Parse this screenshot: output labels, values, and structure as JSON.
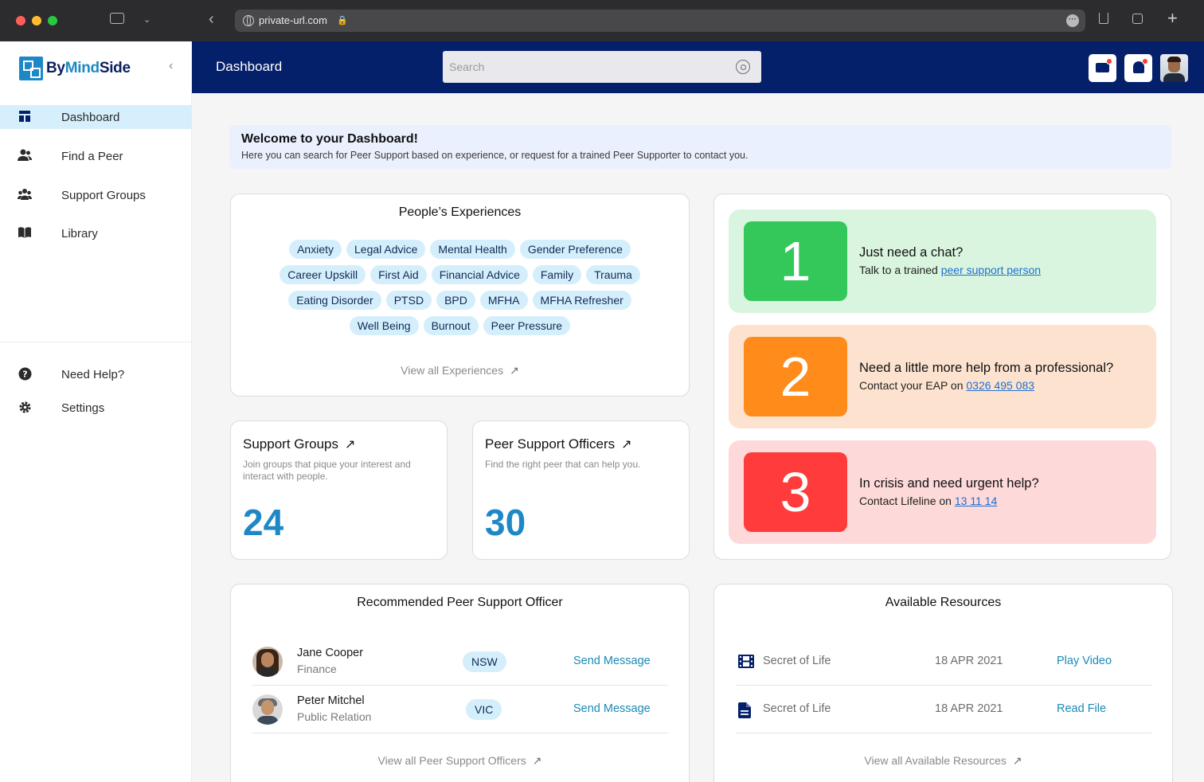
{
  "browser": {
    "url": "private-url.com"
  },
  "sidebar": {
    "brand_prefix": "By",
    "brand_mind": "Mind",
    "brand_suffix": "Side",
    "nav": [
      {
        "label": "Dashboard",
        "icon": "dashboard-icon",
        "active": true
      },
      {
        "label": "Find a Peer",
        "icon": "people-icon",
        "active": false
      },
      {
        "label": "Support Groups",
        "icon": "group-icon",
        "active": false
      },
      {
        "label": "Library",
        "icon": "book-icon",
        "active": false
      }
    ],
    "bottom_nav": [
      {
        "label": "Need Help?",
        "icon": "help-icon"
      },
      {
        "label": "Settings",
        "icon": "gear-icon"
      }
    ]
  },
  "header": {
    "title": "Dashboard",
    "search_placeholder": "Search"
  },
  "welcome": {
    "title": "Welcome to your Dashboard!",
    "subtitle": "Here you can search for Peer Support based on experience, or request for a trained Peer Supporter to contact you."
  },
  "experiences": {
    "title": "People’s Experiences",
    "tags": [
      "Anxiety",
      "Legal Advice",
      "Mental Health",
      "Gender Preference",
      "Career Upskill",
      "First Aid",
      "Financial Advice",
      "Family",
      "Trauma",
      "Eating Disorder",
      "PTSD",
      "BPD",
      "MFHA",
      "MFHA Refresher",
      "Well Being",
      "Burnout",
      "Peer Pressure"
    ],
    "view_all": "View all Experiences"
  },
  "support_groups": {
    "title": "Support Groups",
    "description": "Join groups that pique your interest and interact with people.",
    "count": "24"
  },
  "peer_officers": {
    "title": "Peer Support Officers",
    "description": "Find the right peer that can help you.",
    "count": "30"
  },
  "help_options": [
    {
      "number": "1",
      "title": "Just need a chat?",
      "text": "Talk to a trained ",
      "link": "peer support person",
      "color": "#34c759",
      "bg": "#d9f5df"
    },
    {
      "number": "2",
      "title": "Need a little more help from a professional?",
      "text": "Contact your EAP on ",
      "link": "0326 495 083",
      "color": "#ff8c1a",
      "bg": "#fde3cf"
    },
    {
      "number": "3",
      "title": "In crisis and need urgent help?",
      "text": "Contact Lifeline on ",
      "link": "13 11 14",
      "color": "#ff3b3b",
      "bg": "#fdd9d9"
    }
  ],
  "recommended": {
    "title": "Recommended Peer Support Officer",
    "officers": [
      {
        "name": "Jane Cooper",
        "role": "Finance",
        "state": "NSW",
        "action": "Send Message"
      },
      {
        "name": "Peter Mitchel",
        "role": "Public Relation",
        "state": "VIC",
        "action": "Send Message"
      }
    ],
    "view_all": "View all Peer Support Officers"
  },
  "resources": {
    "title": "Available Resources",
    "items": [
      {
        "name": "Secret of Life",
        "date": "18 APR 2021",
        "action": "Play Video",
        "icon": "video-icon"
      },
      {
        "name": "Secret of Life",
        "date": "18 APR 2021",
        "action": "Read File",
        "icon": "file-icon"
      }
    ],
    "view_all": "View all Available Resources"
  },
  "colors": {
    "navy": "#05206b",
    "accent_blue": "#1e88c7",
    "chip_bg": "#d4effb"
  }
}
